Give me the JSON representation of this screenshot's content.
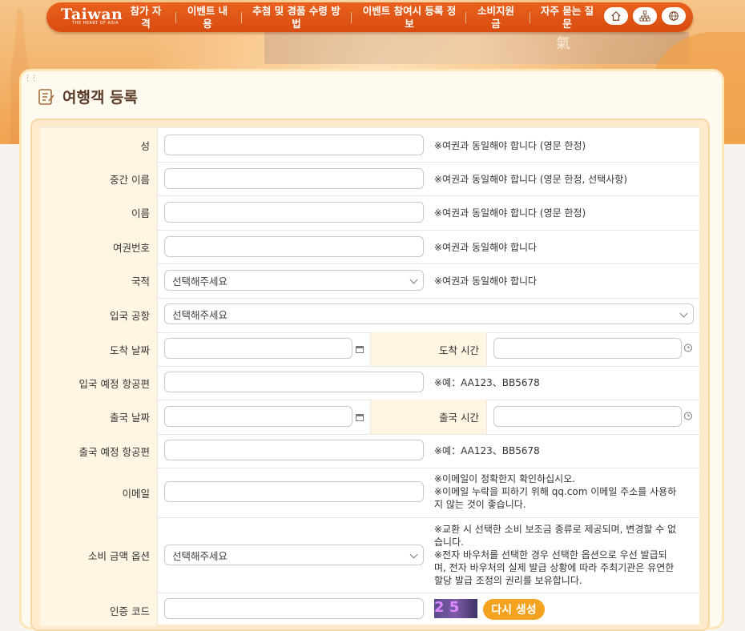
{
  "brand": {
    "logo": "Taiwan",
    "tagline": "THE HEART OF ASIA"
  },
  "hero": {
    "kanji": "氣"
  },
  "nav": {
    "items": [
      {
        "line1": "참가 자",
        "line2": "격"
      },
      {
        "line1": "이벤트 내",
        "line2": "용"
      },
      {
        "line1": "추첨 및 경품 수령 방",
        "line2": "법"
      },
      {
        "line1": "이벤트 참여시 등록 정",
        "line2": "보"
      },
      {
        "line1": "소비지원",
        "line2": "금"
      },
      {
        "line1": "자주 묻는 질",
        "line2": "문"
      }
    ],
    "icons": [
      "home-icon",
      "sitemap-icon",
      "globe-icon"
    ]
  },
  "page": {
    "title": "여행객 등록"
  },
  "form": {
    "surname": {
      "label": "성",
      "value": "",
      "note": "※여권과 동일해야 합니다 (영문 한정)"
    },
    "middle_name": {
      "label": "중간 이름",
      "value": "",
      "note": "※여권과 동일해야 합니다 (영문 한정, 선택사항)"
    },
    "given_name": {
      "label": "이름",
      "value": "",
      "note": "※여권과 동일해야 합니다 (영문 한정)"
    },
    "passport": {
      "label": "여권번호",
      "value": "",
      "note": "※여권과 동일해야 합니다"
    },
    "nationality": {
      "label": "국적",
      "value": "선택해주세요",
      "note": "※여권과 동일해야 합니다"
    },
    "entry_airport": {
      "label": "입국 공항",
      "value": "선택해주세요"
    },
    "arrival_date": {
      "label": "도착 날짜",
      "value": ""
    },
    "arrival_time": {
      "label": "도착 시간",
      "value": ""
    },
    "arrival_flight": {
      "label": "입국 예정 항공편",
      "value": "",
      "note": "※예：AA123、BB5678"
    },
    "departure_date": {
      "label": "출국 날짜",
      "value": ""
    },
    "departure_time": {
      "label": "출국 시간",
      "value": ""
    },
    "departure_flight": {
      "label": "출국 예정 항공편",
      "value": "",
      "note": "※예：AA123、BB5678"
    },
    "email": {
      "label": "이메일",
      "value": "",
      "note1": "※이메일이 정확한지 확인하십시오.",
      "note2": "※이메일 누락을 피하기 위해 qq.com 이메일 주소를 사용하",
      "note3": "지 않는 것이 좋습니다."
    },
    "voucher": {
      "label": "소비 금액 옵션",
      "value": "선택해주세요",
      "note1": "※교환 시 선택한 소비 보조금 종류로 제공되며, 변경할 수 없",
      "note2": "습니다.",
      "note3": "※전자 바우처를 선택한 경우 선택한 옵션으로 우선 발급되",
      "note4": "며, 전자 바우처의 실제 발급 상황에 따라 주최기관은 유연한",
      "note5": "할당 발급 조정의 권리를 보유합니다."
    },
    "captcha": {
      "label": "인증 코드",
      "value": "",
      "image_text": "2 5",
      "regenerate": "다시 생성"
    }
  },
  "colors": {
    "nav": "#e0561a",
    "label_bg": "#fff5e3",
    "accent": "#f4a321",
    "title": "#5a3c2a"
  }
}
